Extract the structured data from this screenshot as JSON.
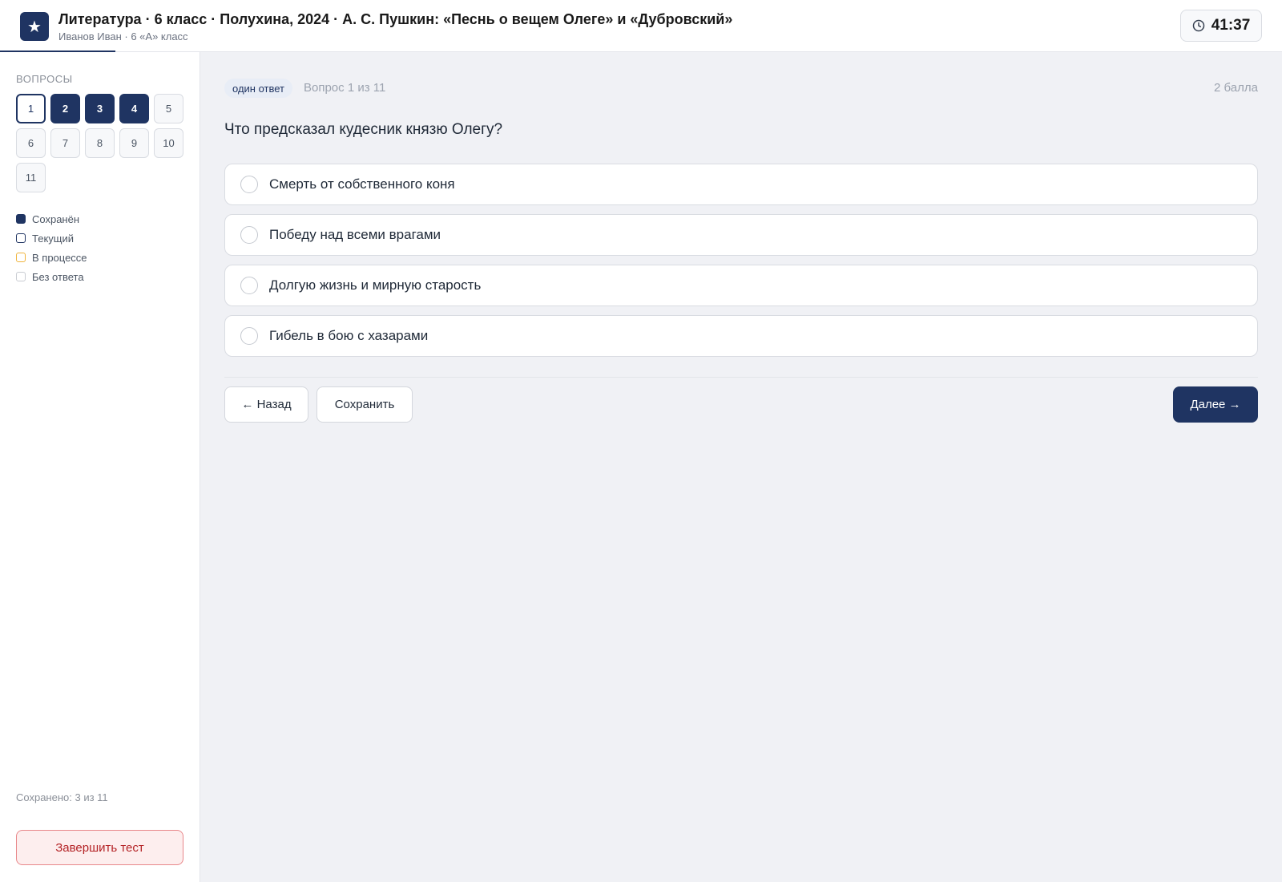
{
  "header": {
    "logo_glyph": "★",
    "title": "Литература · 6 класс · Полухина, 2024 · А. С. Пушкин: «Песнь о вещем Олеге» и «Дубровский»",
    "subtitle": "Иванов Иван · 6 «А» класс",
    "timer": "41:37",
    "timer_icon": "clock-icon"
  },
  "colors": {
    "accent": "#1f3462",
    "in_progress": "#f0b43c",
    "danger": "#b42326"
  },
  "sidebar": {
    "heading": "ВОПРОСЫ",
    "questions": [
      {
        "num": "1",
        "state": "current"
      },
      {
        "num": "2",
        "state": "saved"
      },
      {
        "num": "3",
        "state": "saved"
      },
      {
        "num": "4",
        "state": "saved"
      },
      {
        "num": "5",
        "state": "empty"
      },
      {
        "num": "6",
        "state": "empty"
      },
      {
        "num": "7",
        "state": "empty"
      },
      {
        "num": "8",
        "state": "empty"
      },
      {
        "num": "9",
        "state": "empty"
      },
      {
        "num": "10",
        "state": "empty"
      },
      {
        "num": "11",
        "state": "empty"
      }
    ],
    "legend": [
      {
        "key": "saved",
        "label": "Сохранён"
      },
      {
        "key": "current",
        "label": "Текущий"
      },
      {
        "key": "progress",
        "label": "В процессе"
      },
      {
        "key": "empty",
        "label": "Без ответа"
      }
    ],
    "saved_count": "Сохранено: 3 из 11",
    "finish_label": "Завершить тест"
  },
  "question": {
    "type_tag": "один ответ",
    "number_label": "Вопрос 1 из 11",
    "points": "2 балла",
    "text": "Что предсказал кудесник князю Олегу?",
    "options": [
      "Смерть от собственного коня",
      "Победу над всеми врагами",
      "Долгую жизнь и мирную старость",
      "Гибель в бою с хазарами"
    ]
  },
  "nav": {
    "back_label": "← Назад",
    "save_label": "Сохранить",
    "next_label": "Далее →"
  }
}
